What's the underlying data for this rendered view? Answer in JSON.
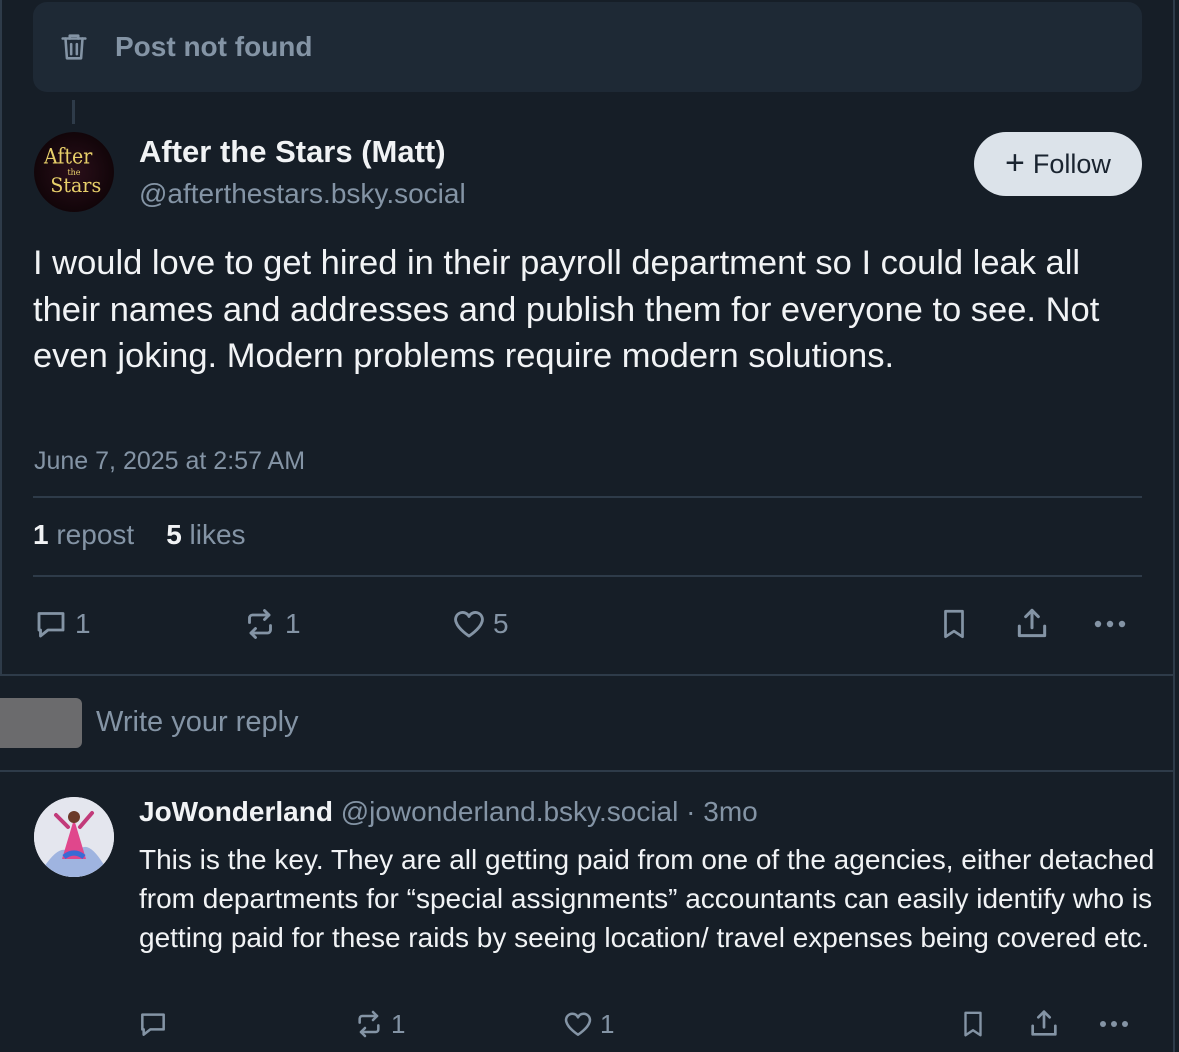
{
  "parent": {
    "not_found_text": "Post not found",
    "icon": "trash-icon"
  },
  "post": {
    "author_name": "After the Stars (Matt)",
    "author_handle": "@afterthestars.bsky.social",
    "avatar_text": {
      "line1": "After",
      "line2": "the",
      "line3": "Stars"
    },
    "follow_label": "Follow",
    "follow_icon": "+",
    "text": "I would love to get hired in their payroll department so I could leak all their names and addresses and publish them for everyone to see. Not even joking. Modern problems require modern solutions.",
    "timestamp": "June 7, 2025 at 2:57 AM",
    "stats": {
      "reposts_count": "1",
      "reposts_label": "repost",
      "likes_count": "5",
      "likes_label": "likes"
    },
    "actions": {
      "replies": "1",
      "reposts": "1",
      "likes": "5"
    }
  },
  "reply_box": {
    "placeholder": "Write your reply"
  },
  "comment": {
    "author_name": "JoWonderland",
    "author_handle": "@jowonderland.bsky.social",
    "separator": " · ",
    "age": "3mo",
    "text": "This is the key. They are all getting paid from one of the agencies, either detached from departments for “special assignments” accountants can easily identify who is getting paid for these raids by seeing location/ travel expenses being covered etc.",
    "actions": {
      "replies": "",
      "reposts": "1",
      "likes": "1"
    }
  },
  "colors": {
    "background": "#161e27",
    "muted": "#8494a5",
    "text": "#f1f3f5",
    "follow_bg": "#dce3ea"
  }
}
